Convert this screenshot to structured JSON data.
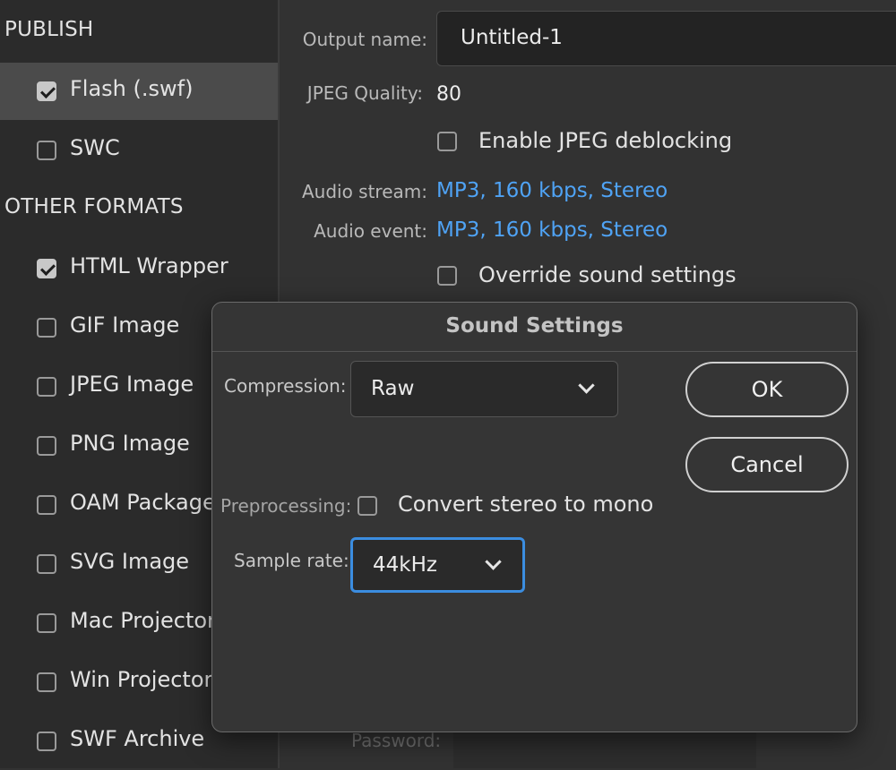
{
  "sidebar": {
    "publish_header": "PUBLISH",
    "other_formats_header": "OTHER FORMATS",
    "publish_items": [
      {
        "label": "Flash (.swf)",
        "checked": true,
        "selected": true
      },
      {
        "label": "SWC",
        "checked": false,
        "selected": false
      }
    ],
    "other_items": [
      {
        "label": "HTML Wrapper",
        "checked": true
      },
      {
        "label": "GIF Image",
        "checked": false
      },
      {
        "label": "JPEG Image",
        "checked": false
      },
      {
        "label": "PNG Image",
        "checked": false
      },
      {
        "label": "OAM Package",
        "checked": false
      },
      {
        "label": "SVG Image",
        "checked": false
      },
      {
        "label": "Mac Projector",
        "checked": false
      },
      {
        "label": "Win Projector",
        "checked": false
      },
      {
        "label": "SWF Archive",
        "checked": false
      }
    ]
  },
  "main": {
    "output_name_label": "Output name:",
    "output_name_value": "Untitled-1",
    "jpeg_quality_label": "JPEG Quality:",
    "jpeg_quality_value": "80",
    "enable_jpeg_deblocking": "Enable JPEG deblocking",
    "audio_stream_label": "Audio stream:",
    "audio_stream_value": "MP3, 160 kbps, Stereo",
    "audio_event_label": "Audio event:",
    "audio_event_value": "MP3, 160 kbps, Stereo",
    "override_sound": "Override sound settings",
    "password_label": "Password:"
  },
  "dialog": {
    "title": "Sound Settings",
    "compression_label": "Compression:",
    "compression_value": "Raw",
    "preprocessing_label": "Preprocessing:",
    "convert_stereo": "Convert stereo to mono",
    "sample_rate_label": "Sample rate:",
    "sample_rate_value": "44kHz",
    "ok_label": "OK",
    "cancel_label": "Cancel"
  },
  "colors": {
    "link": "#4fa3f5",
    "focus": "#3b8de0",
    "background": "#323232"
  }
}
